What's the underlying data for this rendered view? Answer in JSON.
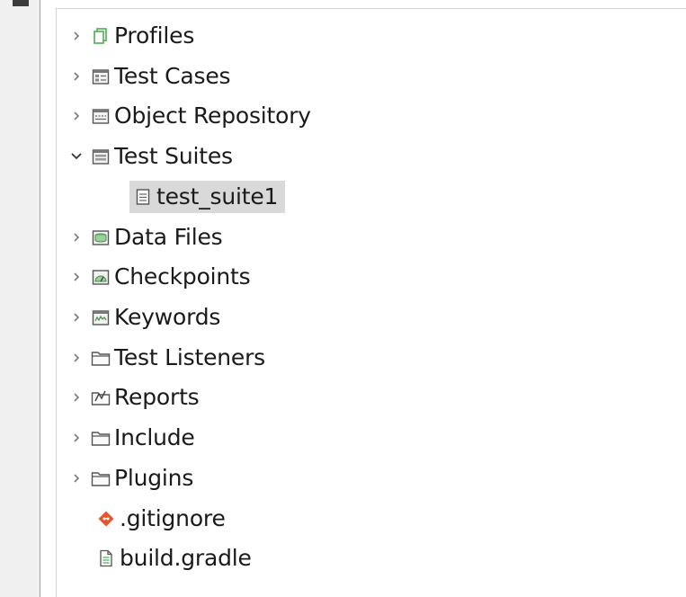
{
  "tree": {
    "items": [
      {
        "label": "Profiles",
        "icon": "profiles-icon",
        "state": "collapsed"
      },
      {
        "label": "Test Cases",
        "icon": "test-cases-icon",
        "state": "collapsed"
      },
      {
        "label": "Object Repository",
        "icon": "object-repository-icon",
        "state": "collapsed"
      },
      {
        "label": "Test Suites",
        "icon": "test-suites-icon",
        "state": "expanded"
      },
      {
        "label": "test_suite1",
        "icon": "test-suite-file-icon",
        "state": "leaf",
        "selected": true
      },
      {
        "label": "Data Files",
        "icon": "data-files-icon",
        "state": "collapsed"
      },
      {
        "label": "Checkpoints",
        "icon": "checkpoints-icon",
        "state": "collapsed"
      },
      {
        "label": "Keywords",
        "icon": "keywords-icon",
        "state": "collapsed"
      },
      {
        "label": "Test Listeners",
        "icon": "folder-icon",
        "state": "collapsed"
      },
      {
        "label": "Reports",
        "icon": "reports-icon",
        "state": "collapsed"
      },
      {
        "label": "Include",
        "icon": "folder-icon",
        "state": "collapsed"
      },
      {
        "label": "Plugins",
        "icon": "folder-icon",
        "state": "collapsed"
      },
      {
        "label": ".gitignore",
        "icon": "git-icon",
        "state": "leaf"
      },
      {
        "label": "build.gradle",
        "icon": "file-icon",
        "state": "leaf"
      }
    ]
  },
  "colors": {
    "selection": "#d9d9d9",
    "profiles_green": "#4caf50",
    "git_orange": "#e8542b"
  }
}
